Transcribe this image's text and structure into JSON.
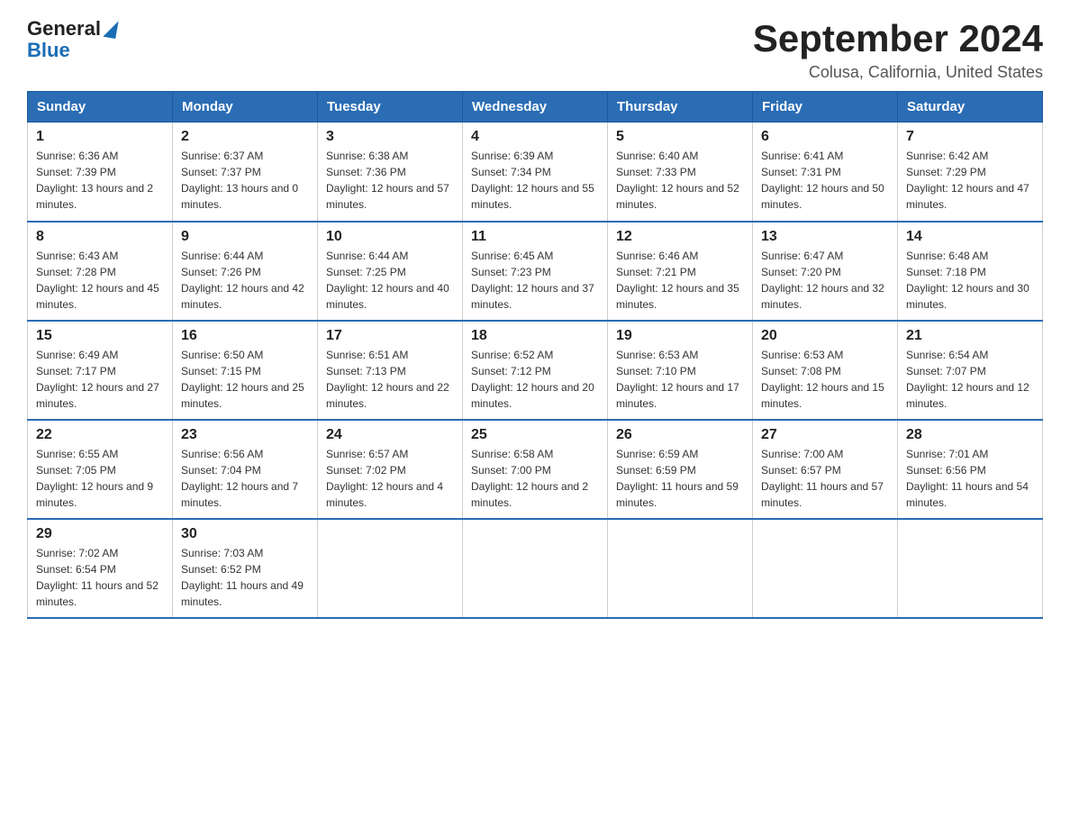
{
  "logo": {
    "general": "General",
    "blue": "Blue"
  },
  "title": {
    "month_year": "September 2024",
    "location": "Colusa, California, United States"
  },
  "weekdays": [
    "Sunday",
    "Monday",
    "Tuesday",
    "Wednesday",
    "Thursday",
    "Friday",
    "Saturday"
  ],
  "weeks": [
    [
      {
        "day": "1",
        "sunrise": "6:36 AM",
        "sunset": "7:39 PM",
        "daylight": "13 hours and 2 minutes."
      },
      {
        "day": "2",
        "sunrise": "6:37 AM",
        "sunset": "7:37 PM",
        "daylight": "13 hours and 0 minutes."
      },
      {
        "day": "3",
        "sunrise": "6:38 AM",
        "sunset": "7:36 PM",
        "daylight": "12 hours and 57 minutes."
      },
      {
        "day": "4",
        "sunrise": "6:39 AM",
        "sunset": "7:34 PM",
        "daylight": "12 hours and 55 minutes."
      },
      {
        "day": "5",
        "sunrise": "6:40 AM",
        "sunset": "7:33 PM",
        "daylight": "12 hours and 52 minutes."
      },
      {
        "day": "6",
        "sunrise": "6:41 AM",
        "sunset": "7:31 PM",
        "daylight": "12 hours and 50 minutes."
      },
      {
        "day": "7",
        "sunrise": "6:42 AM",
        "sunset": "7:29 PM",
        "daylight": "12 hours and 47 minutes."
      }
    ],
    [
      {
        "day": "8",
        "sunrise": "6:43 AM",
        "sunset": "7:28 PM",
        "daylight": "12 hours and 45 minutes."
      },
      {
        "day": "9",
        "sunrise": "6:44 AM",
        "sunset": "7:26 PM",
        "daylight": "12 hours and 42 minutes."
      },
      {
        "day": "10",
        "sunrise": "6:44 AM",
        "sunset": "7:25 PM",
        "daylight": "12 hours and 40 minutes."
      },
      {
        "day": "11",
        "sunrise": "6:45 AM",
        "sunset": "7:23 PM",
        "daylight": "12 hours and 37 minutes."
      },
      {
        "day": "12",
        "sunrise": "6:46 AM",
        "sunset": "7:21 PM",
        "daylight": "12 hours and 35 minutes."
      },
      {
        "day": "13",
        "sunrise": "6:47 AM",
        "sunset": "7:20 PM",
        "daylight": "12 hours and 32 minutes."
      },
      {
        "day": "14",
        "sunrise": "6:48 AM",
        "sunset": "7:18 PM",
        "daylight": "12 hours and 30 minutes."
      }
    ],
    [
      {
        "day": "15",
        "sunrise": "6:49 AM",
        "sunset": "7:17 PM",
        "daylight": "12 hours and 27 minutes."
      },
      {
        "day": "16",
        "sunrise": "6:50 AM",
        "sunset": "7:15 PM",
        "daylight": "12 hours and 25 minutes."
      },
      {
        "day": "17",
        "sunrise": "6:51 AM",
        "sunset": "7:13 PM",
        "daylight": "12 hours and 22 minutes."
      },
      {
        "day": "18",
        "sunrise": "6:52 AM",
        "sunset": "7:12 PM",
        "daylight": "12 hours and 20 minutes."
      },
      {
        "day": "19",
        "sunrise": "6:53 AM",
        "sunset": "7:10 PM",
        "daylight": "12 hours and 17 minutes."
      },
      {
        "day": "20",
        "sunrise": "6:53 AM",
        "sunset": "7:08 PM",
        "daylight": "12 hours and 15 minutes."
      },
      {
        "day": "21",
        "sunrise": "6:54 AM",
        "sunset": "7:07 PM",
        "daylight": "12 hours and 12 minutes."
      }
    ],
    [
      {
        "day": "22",
        "sunrise": "6:55 AM",
        "sunset": "7:05 PM",
        "daylight": "12 hours and 9 minutes."
      },
      {
        "day": "23",
        "sunrise": "6:56 AM",
        "sunset": "7:04 PM",
        "daylight": "12 hours and 7 minutes."
      },
      {
        "day": "24",
        "sunrise": "6:57 AM",
        "sunset": "7:02 PM",
        "daylight": "12 hours and 4 minutes."
      },
      {
        "day": "25",
        "sunrise": "6:58 AM",
        "sunset": "7:00 PM",
        "daylight": "12 hours and 2 minutes."
      },
      {
        "day": "26",
        "sunrise": "6:59 AM",
        "sunset": "6:59 PM",
        "daylight": "11 hours and 59 minutes."
      },
      {
        "day": "27",
        "sunrise": "7:00 AM",
        "sunset": "6:57 PM",
        "daylight": "11 hours and 57 minutes."
      },
      {
        "day": "28",
        "sunrise": "7:01 AM",
        "sunset": "6:56 PM",
        "daylight": "11 hours and 54 minutes."
      }
    ],
    [
      {
        "day": "29",
        "sunrise": "7:02 AM",
        "sunset": "6:54 PM",
        "daylight": "11 hours and 52 minutes."
      },
      {
        "day": "30",
        "sunrise": "7:03 AM",
        "sunset": "6:52 PM",
        "daylight": "11 hours and 49 minutes."
      },
      null,
      null,
      null,
      null,
      null
    ]
  ]
}
